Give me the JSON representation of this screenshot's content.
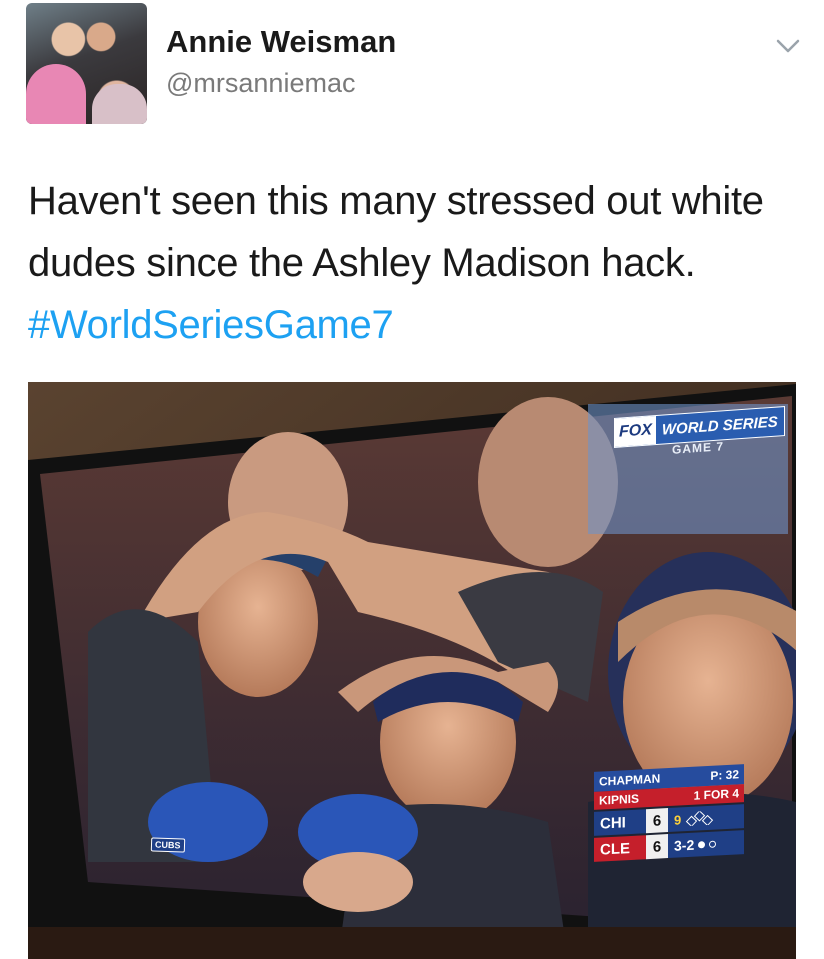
{
  "header": {
    "display_name": "Annie Weisman",
    "handle": "@mrsanniemac",
    "avatar_icon": "profile-photo",
    "menu_icon": "chevron-down-icon"
  },
  "tweet": {
    "text": "Haven't seen this many stressed out white dudes since the Ashley Madison hack. ",
    "hashtag": "#WorldSeriesGame7",
    "hashtag_color": "#1da1f2"
  },
  "media": {
    "network_logo": "FOX",
    "event": "WORLD SERIES",
    "game": "GAME 7",
    "cap_tag": "CUBS",
    "scoreboard": {
      "pitcher": "CHAPMAN",
      "pitch_count": "P: 32",
      "batter": "KIPNIS",
      "batter_stats": "1 FOR 4",
      "away_team": "CHI",
      "away_score": "6",
      "home_team": "CLE",
      "home_score": "6",
      "inning": "9",
      "count": "3-2",
      "away_color": "#1f3f86",
      "home_color": "#c51f2b"
    }
  }
}
